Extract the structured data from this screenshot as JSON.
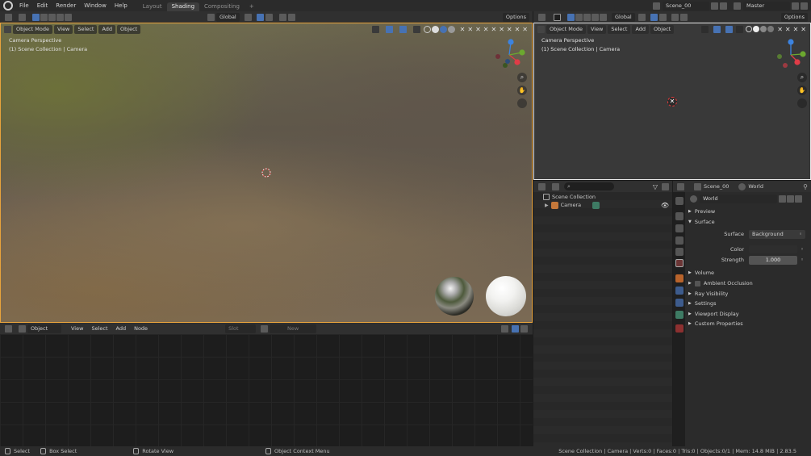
{
  "topbar": {
    "menus": [
      "File",
      "Edit",
      "Render",
      "Window",
      "Help"
    ],
    "tabs": [
      "Layout",
      "Shading",
      "Compositing"
    ],
    "add_tab": "+",
    "scene": "Scene_00",
    "view_layer": "Master"
  },
  "vp_main": {
    "mode": "Object Mode",
    "menus": [
      "View",
      "Select",
      "Add",
      "Object"
    ],
    "orientation": "Global",
    "options": "Options",
    "overlay_line1": "Camera Perspective",
    "overlay_line2": "(1) Scene Collection | Camera"
  },
  "vp_right": {
    "mode": "Object Mode",
    "menus": [
      "View",
      "Select",
      "Add",
      "Object"
    ],
    "orientation": "Global",
    "options": "Options",
    "overlay_line1": "Camera Perspective",
    "overlay_line2": "(1) Scene Collection | Camera"
  },
  "node_editor": {
    "type": "Object",
    "menus": [
      "View",
      "Select",
      "Add",
      "Node"
    ],
    "slot": "Slot",
    "new_btn": "New"
  },
  "outliner": {
    "collection": "Scene Collection",
    "items": [
      {
        "label": "Camera"
      }
    ]
  },
  "properties": {
    "scene": "Scene_00",
    "world_tab": "World",
    "world_name": "World",
    "sections": {
      "preview": "Preview",
      "surface": "Surface",
      "volume": "Volume",
      "ambient_occlusion": "Ambient Occlusion",
      "ray_visibility": "Ray Visibility",
      "settings": "Settings",
      "viewport_display": "Viewport Display",
      "custom_properties": "Custom Properties"
    },
    "fields": {
      "surface_label": "Surface",
      "surface_value": "Background",
      "color_label": "Color",
      "strength_label": "Strength",
      "strength_value": "1.000"
    }
  },
  "status": {
    "select": "Select",
    "box_select": "Box Select",
    "rotate_view": "Rotate View",
    "context_menu": "Object Context Menu",
    "stats": "Scene Collection | Camera | Verts:0 | Faces:0 | Tris:0 | Objects:0/1 | Mem: 14.8 MiB | 2.83.5"
  },
  "colors": {
    "accent": "#4772b3",
    "selected_outline": "#e8a33c",
    "gizmo_x": "#e03c47",
    "gizmo_y": "#6ca82f",
    "gizmo_z": "#3c83e0"
  }
}
